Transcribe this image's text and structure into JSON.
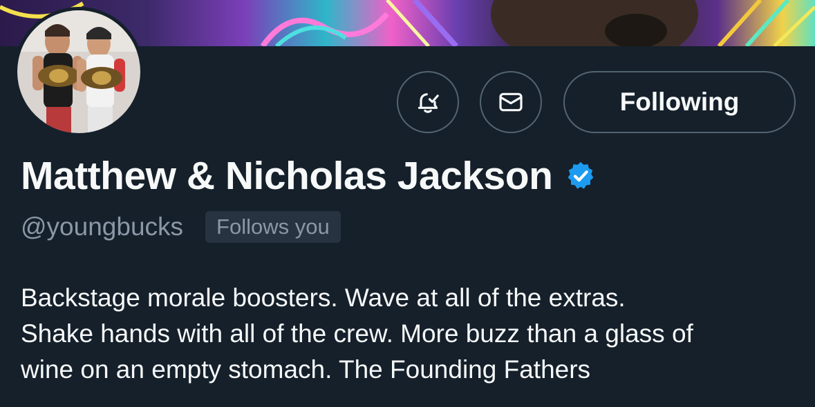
{
  "profile": {
    "display_name": "Matthew & Nicholas Jackson",
    "handle": "@youngbucks",
    "follows_badge": "Follows you",
    "bio_lines": [
      "Backstage morale boosters. Wave at all of the extras.",
      "Shake hands with all of the crew. More buzz than a glass of",
      "wine on an empty stomach. The Founding Fathers"
    ]
  },
  "actions": {
    "notify_icon": "bell-check-icon",
    "message_icon": "envelope-icon",
    "following_label": "Following"
  },
  "colors": {
    "background": "#15202b",
    "text_primary": "#f7f9f9",
    "text_secondary": "#8b98a5",
    "border": "#536471",
    "verified": "#1d9bf0",
    "badge_bg": "#273340"
  }
}
